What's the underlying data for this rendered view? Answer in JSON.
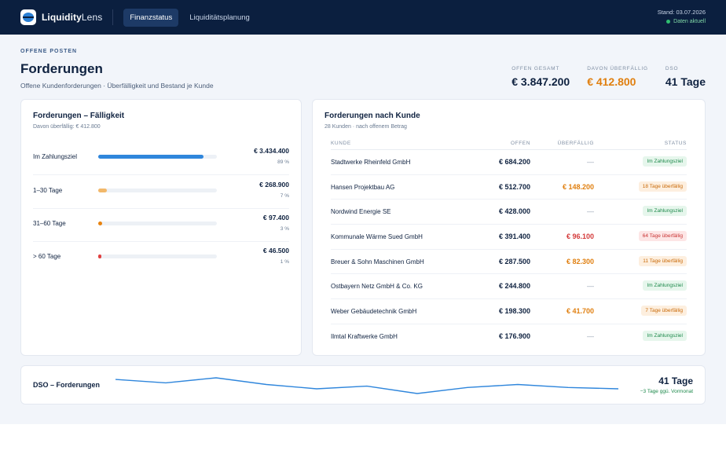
{
  "app": {
    "brand_bold": "Liquidity",
    "brand_light": "Lens",
    "tabs": [
      {
        "label": "Finanzstatus",
        "active": true
      },
      {
        "label": "Liquiditätsplanung",
        "active": false
      }
    ],
    "stand": "Stand: 03.07.2026",
    "live_status": "Daten aktuell"
  },
  "page": {
    "eyebrow": "OFFENE POSTEN",
    "title": "Forderungen",
    "subtitle": "Offene Kundenforderungen · Überfälligkeit und Bestand je Kunde"
  },
  "kpis": [
    {
      "label": "OFFEN GESAMT",
      "value": "€ 3.847.200",
      "tone": "normal"
    },
    {
      "label": "DAVON ÜBERFÄLLIG",
      "value": "€ 412.800",
      "tone": "warn"
    },
    {
      "label": "DSO",
      "value": "41 Tage",
      "tone": "normal"
    }
  ],
  "aging": {
    "title": "Forderungen – Fälligkeit",
    "subtitle": "Davon überfällig: € 412.800",
    "rows": [
      {
        "label": "Im Zahlungsziel",
        "amount": "€ 3.434.400",
        "pct": "89 %",
        "share": 0.89,
        "color": "#2f86dc"
      },
      {
        "label": "1–30 Tage",
        "amount": "€ 268.900",
        "pct": "7 %",
        "share": 0.07,
        "color": "#f2b86a"
      },
      {
        "label": "31–60 Tage",
        "amount": "€ 97.400",
        "pct": "3 %",
        "share": 0.03,
        "color": "#e8830f"
      },
      {
        "label": "> 60 Tage",
        "amount": "€ 46.500",
        "pct": "1 %",
        "share": 0.01,
        "color": "#e04040"
      }
    ]
  },
  "customers": {
    "title": "Forderungen nach Kunde",
    "subtitle": "28 Kunden · nach offenem Betrag",
    "columns": {
      "name": "KUNDE",
      "open": "OFFEN",
      "overdue": "ÜBERFÄLLIG",
      "status": "STATUS"
    },
    "rows": [
      {
        "name": "Stadtwerke Rheinfeld GmbH",
        "open": "€ 684.200",
        "overdue": "—",
        "over_tone": "none",
        "status": "Im Zahlungsziel",
        "status_tone": "ok"
      },
      {
        "name": "Hansen Projektbau AG",
        "open": "€ 512.700",
        "overdue": "€ 148.200",
        "over_tone": "mid",
        "status": "18 Tage überfällig",
        "status_tone": "mid"
      },
      {
        "name": "Nordwind Energie SE",
        "open": "€ 428.000",
        "overdue": "—",
        "over_tone": "none",
        "status": "Im Zahlungsziel",
        "status_tone": "ok"
      },
      {
        "name": "Kommunale Wärme Sued GmbH",
        "open": "€ 391.400",
        "overdue": "€ 96.100",
        "over_tone": "high",
        "status": "64 Tage überfällig",
        "status_tone": "high"
      },
      {
        "name": "Breuer & Sohn Maschinen GmbH",
        "open": "€ 287.500",
        "overdue": "€ 82.300",
        "over_tone": "mid",
        "status": "11 Tage überfällig",
        "status_tone": "mid"
      },
      {
        "name": "Ostbayern Netz GmbH & Co. KG",
        "open": "€ 244.800",
        "overdue": "—",
        "over_tone": "none",
        "status": "Im Zahlungsziel",
        "status_tone": "ok"
      },
      {
        "name": "Weber Gebäudetechnik GmbH",
        "open": "€ 198.300",
        "overdue": "€ 41.700",
        "over_tone": "mid",
        "status": "7 Tage überfällig",
        "status_tone": "mid"
      },
      {
        "name": "Ilmtal Kraftwerke GmbH",
        "open": "€ 176.900",
        "overdue": "—",
        "over_tone": "none",
        "status": "Im Zahlungsziel",
        "status_tone": "ok"
      }
    ]
  },
  "dso": {
    "title": "DSO – Forderungen",
    "value": "41 Tage",
    "delta": "−3 Tage ggü. Vormonat",
    "line_color": "#2f86dc",
    "trend": [
      44,
      43,
      44.5,
      42.5,
      41.2,
      42,
      39.8,
      41.6,
      42.5,
      41.6,
      41.2
    ]
  }
}
